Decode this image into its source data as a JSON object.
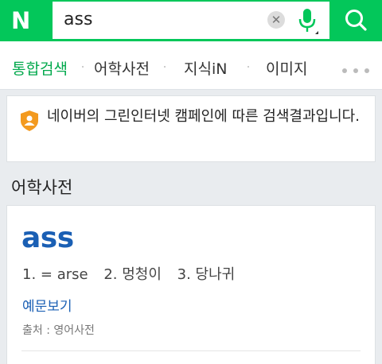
{
  "header": {
    "logo": "N",
    "query": "ass"
  },
  "tabs": [
    {
      "label": "통합검색"
    },
    {
      "label": "어학사전"
    },
    {
      "label": "지식iN"
    },
    {
      "label": "이미지"
    }
  ],
  "notice": {
    "text": "네이버의 그린인터넷 캠페인에 따른 검색결과입니다."
  },
  "section": {
    "title": "어학사전"
  },
  "dictionary": {
    "word": "ass",
    "meanings": [
      "1. = arse",
      "2. 멍청이",
      "3. 당나귀"
    ],
    "examples_link": "예문보기",
    "source": "출처 : 영어사전"
  },
  "colors": {
    "brand": "#03c75a",
    "link": "#1a5fb4"
  }
}
